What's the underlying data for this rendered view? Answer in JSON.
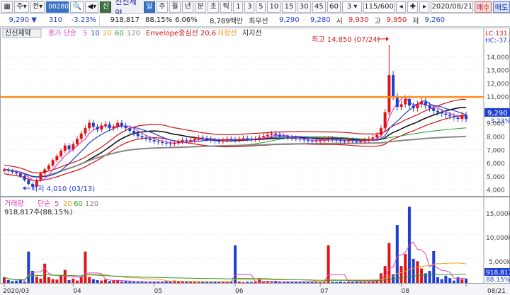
{
  "toolbar": {
    "menu1": "주",
    "menu2": "전",
    "code": "002800",
    "market_badge": "신",
    "name": "신신제약",
    "periods": [
      "일",
      "주",
      "월",
      "년",
      "분",
      "초",
      "틱"
    ],
    "minutes": [
      "1",
      "3",
      "5",
      "10",
      "15",
      "30",
      "45",
      "60"
    ],
    "interval": "3",
    "zoom": "115/600",
    "date": "2020/08/21",
    "buy": "매수",
    "sell": "매도"
  },
  "quote": {
    "price": "9,290",
    "change": "310",
    "change_pct": "-3.23%",
    "volume": "918,817",
    "vol_ratio": "88.15%",
    "turnover": "6.06%",
    "amount": "8,789백만",
    "ask_label": "최우선",
    "ask1": "9,290",
    "ask2": "9,280",
    "open_label": "시",
    "open": "9,930",
    "high_label": "고",
    "high": "9,950",
    "low_label": "저",
    "low": "9,260"
  },
  "price_panel": {
    "legend": {
      "name": "신신제약",
      "ma_label": "종가 단순",
      "ma_periods": [
        "5",
        "10",
        "20",
        "60",
        "120"
      ],
      "envelope": "Envelope중심선 20,6",
      "resistance": "저항선",
      "support": "지지선"
    },
    "lc_label": "LC:131.6",
    "hc_label": "HC:-37.4",
    "max_label": "최고 14,850 (07/24)",
    "min_label": "최저 4,010 (03/13)",
    "price_tag": "9,290",
    "pct_tag": "-3.23%",
    "y_ticks": [
      "14,000",
      "13,000",
      "12,000",
      "11,000",
      "10,000",
      "9,000",
      "8,000",
      "7,000",
      "6,000",
      "5,000",
      "4,000"
    ]
  },
  "volume_panel": {
    "legend": {
      "title": "거래량",
      "ma_label": "단순",
      "ma_periods": [
        "5",
        "20",
        "60",
        "120"
      ],
      "current": "918,817주(88,15%)"
    },
    "y_ticks": [
      "15,000k",
      "10,000k",
      "5,000k"
    ],
    "vol_tag": "918,817",
    "pct_tag": "88.15%"
  },
  "x_axis": [
    "2020/03",
    "04",
    "05",
    "06",
    "07",
    "08",
    "08/21"
  ],
  "colors": {
    "up": "#e01414",
    "down": "#1f3fd0",
    "ma5": "#e040c0",
    "ma10": "#1f3fd0",
    "ma20": "#e8a020",
    "ma60": "#2a9a2a",
    "ma120": "#888888",
    "resistance": "#ff8c1a",
    "envelope": "#d01010"
  },
  "chart_data": {
    "type": "candlestick",
    "resistance": 10950,
    "max": {
      "value": 14850,
      "date": "07/24"
    },
    "min": {
      "value": 4010,
      "date": "03/13"
    },
    "last": 9290,
    "closes": [
      5500,
      5400,
      5300,
      5200,
      5000,
      4700,
      4400,
      4200,
      4700,
      5200,
      5500,
      5800,
      6200,
      6500,
      6900,
      7300,
      7000,
      7400,
      7800,
      8200,
      8600,
      9000,
      8700,
      8500,
      8800,
      8900,
      8600,
      8700,
      9000,
      8800,
      8600,
      8400,
      8200,
      8000,
      7900,
      7800,
      7700,
      7600,
      7550,
      7500,
      7450,
      7400,
      7500,
      7600,
      7700,
      7650,
      7700,
      7800,
      7900,
      7850,
      7800,
      7700,
      7650,
      7600,
      7700,
      7800,
      7750,
      7700,
      7800,
      7850,
      7800,
      7750,
      7800,
      7900,
      8000,
      8100,
      8200,
      8100,
      8000,
      7950,
      7900,
      7850,
      7800,
      7750,
      7700,
      7650,
      7600,
      7650,
      7700,
      7750,
      7800,
      7750,
      7700,
      7650,
      7600,
      7700,
      7650,
      7600,
      7600,
      7700,
      7800,
      7900,
      8100,
      8600,
      9800,
      12600,
      11000,
      10200,
      10400,
      10800,
      10300,
      10100,
      10400,
      10600,
      10300,
      10100,
      9900,
      9800,
      9700,
      9600,
      9500,
      9400,
      9300,
      9600,
      9290
    ],
    "volumes_k": [
      1200,
      600,
      400,
      500,
      800,
      300,
      6500,
      2500,
      1300,
      900,
      4000,
      1200,
      800,
      700,
      1500,
      2700,
      600,
      900,
      500,
      1300,
      6500,
      1200,
      800,
      600,
      500,
      700,
      400,
      500,
      600,
      300,
      400,
      300,
      250,
      200,
      300,
      200,
      250,
      200,
      300,
      250,
      400,
      300,
      500,
      400,
      300,
      250,
      200,
      300,
      250,
      200,
      300,
      200,
      250,
      200,
      300,
      200,
      250,
      7800,
      300,
      200,
      250,
      200,
      300,
      900,
      200,
      250,
      200,
      300,
      250,
      200,
      300,
      200,
      250,
      200,
      300,
      200,
      250,
      200,
      300,
      200,
      7800,
      250,
      200,
      300,
      200,
      250,
      300,
      400,
      300,
      250,
      300,
      400,
      600,
      2000,
      3500,
      8300,
      1800,
      12000,
      3500,
      6000,
      15800,
      5000,
      4500,
      3000,
      2000,
      2500,
      6600,
      1200,
      800,
      1500,
      1000,
      500,
      1200,
      800,
      918
    ]
  }
}
